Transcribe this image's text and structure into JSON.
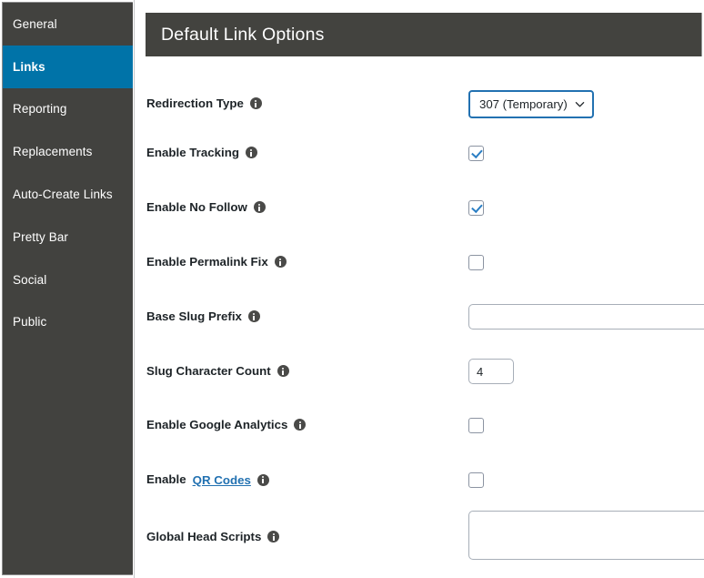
{
  "sidebar": {
    "items": [
      {
        "label": "General",
        "active": false
      },
      {
        "label": "Links",
        "active": true
      },
      {
        "label": "Reporting",
        "active": false
      },
      {
        "label": "Replacements",
        "active": false
      },
      {
        "label": "Auto-Create Links",
        "active": false
      },
      {
        "label": "Pretty Bar",
        "active": false
      },
      {
        "label": "Social",
        "active": false
      },
      {
        "label": "Public",
        "active": false
      }
    ],
    "active_color": "#0073a8",
    "background_color": "#42423f"
  },
  "panel": {
    "title": "Default Link Options",
    "header_background": "#43433f"
  },
  "fields": {
    "redirection_type": {
      "label": "Redirection Type",
      "info_icon": "info-icon",
      "control": "select",
      "value": "307 (Temporary)",
      "chevron_icon": "chevron-down-icon",
      "focus_color": "#2271b1"
    },
    "enable_tracking": {
      "label": "Enable Tracking",
      "info_icon": "info-icon",
      "control": "checkbox",
      "checked": true
    },
    "enable_no_follow": {
      "label": "Enable No Follow",
      "info_icon": "info-icon",
      "control": "checkbox",
      "checked": true
    },
    "enable_permalink_fix": {
      "label": "Enable Permalink Fix",
      "info_icon": "info-icon",
      "control": "checkbox",
      "checked": false
    },
    "base_slug_prefix": {
      "label": "Base Slug Prefix",
      "info_icon": "info-icon",
      "control": "text",
      "value": "",
      "placeholder": ""
    },
    "slug_character_count": {
      "label": "Slug Character Count",
      "info_icon": "info-icon",
      "control": "text",
      "value": "4",
      "placeholder": ""
    },
    "enable_google_analytics": {
      "label": "Enable Google Analytics",
      "info_icon": "info-icon",
      "control": "checkbox",
      "checked": false
    },
    "enable_qr_codes": {
      "label_prefix": "Enable",
      "label_link": "QR Codes",
      "info_icon": "info-icon",
      "control": "checkbox",
      "checked": false,
      "link_color": "#2271b1"
    },
    "global_head_scripts": {
      "label": "Global Head Scripts",
      "info_icon": "info-icon",
      "control": "textarea",
      "value": "",
      "placeholder": ""
    }
  }
}
